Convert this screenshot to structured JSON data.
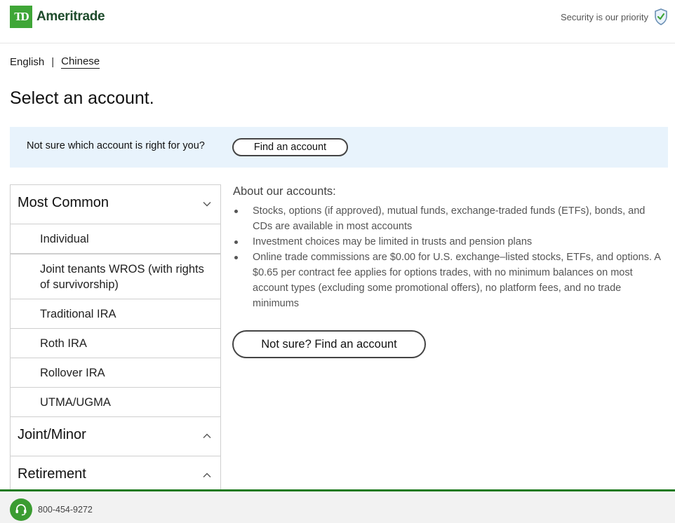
{
  "header": {
    "logo_mark": "TD",
    "logo_text": "Ameritrade",
    "security_text": "Security is our priority",
    "brand_color": "#3fa637"
  },
  "lang": {
    "english": "English",
    "separator": "|",
    "chinese": "Chinese"
  },
  "page_title": "Select an account.",
  "banner": {
    "text": "Not sure which account is right for you?",
    "button": "Find an account"
  },
  "accordion": {
    "sections": [
      {
        "label": "Most Common",
        "expanded": true,
        "items": [
          "Individual",
          "Joint tenants WROS (with rights of survivorship)",
          "Traditional IRA",
          "Roth IRA",
          "Rollover IRA",
          "UTMA/UGMA"
        ]
      },
      {
        "label": "Joint/Minor",
        "expanded": false,
        "items": []
      },
      {
        "label": "Retirement",
        "expanded": false,
        "items": []
      }
    ]
  },
  "about": {
    "title": "About our accounts:",
    "bullets": [
      "Stocks, options (if approved), mutual funds, exchange-traded funds (ETFs), bonds, and CDs are available in most accounts",
      "Investment choices may be limited in trusts and pension plans",
      "Online trade commissions are $0.00 for U.S. exchange–listed stocks, ETFs, and options. A $0.65 per contract fee applies for options trades, with no minimum balances on most account types (excluding some promotional offers), no platform fees, and no trade minimums"
    ],
    "cta": "Not sure? Find an account"
  },
  "footer": {
    "phone": "800-454-9272",
    "accent_color": "#1e7a1e"
  },
  "icons": {
    "security": "shield-check-icon",
    "chevron_expanded": "chevron-down-icon",
    "chevron_collapsed": "chevron-up-icon",
    "phone": "headset-icon"
  }
}
